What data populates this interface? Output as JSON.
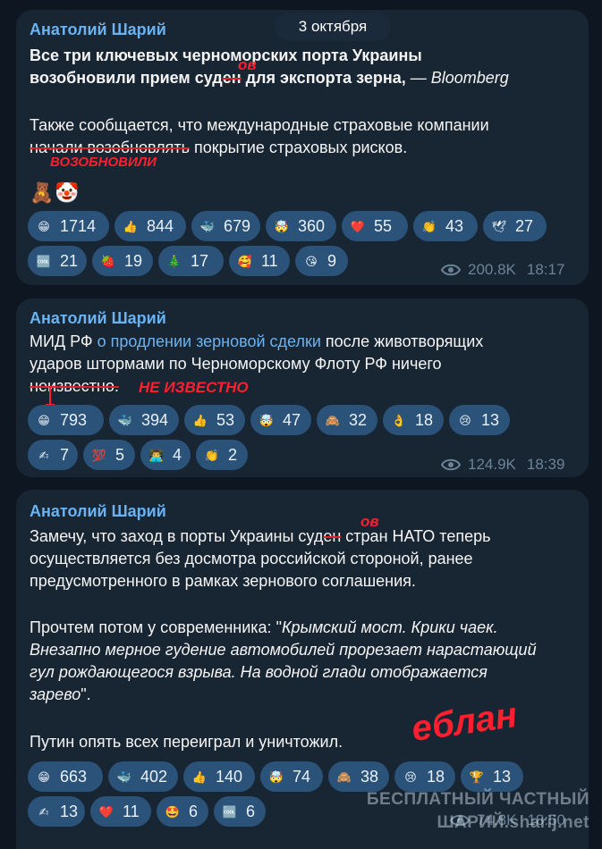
{
  "date_pill": "3 октября",
  "messages": [
    {
      "author": "Анатолий Шарий",
      "line1": "Все три ключевых черноморских порта Украины",
      "line2_a": "возобновили прием суд",
      "line2_strike": "ен",
      "line2_b": " для экспорта зерна,",
      "line2_c": " — ",
      "line2_src": "Bloomberg",
      "p2_line1": "Также сообщается, что международные страховые компании",
      "p2_strike": "начали возобновлять",
      "p2_rest": " покрытие страховых рисков.",
      "ann_ov": "ов",
      "ann_word": "ВОЗОБНОВИЛИ",
      "extra_emoji": [
        "🧸",
        "🤡"
      ],
      "reactions": [
        {
          "emoji": "😁",
          "count": "1714"
        },
        {
          "emoji": "👍",
          "count": "844"
        },
        {
          "emoji": "🐳",
          "count": "679"
        },
        {
          "emoji": "🤯",
          "count": "360"
        },
        {
          "emoji": "❤️",
          "count": "55"
        },
        {
          "emoji": "👏",
          "count": "43"
        },
        {
          "emoji": "🕊",
          "count": "27"
        },
        {
          "emoji": "🆒",
          "count": "21"
        },
        {
          "emoji": "🍓",
          "count": "19"
        },
        {
          "emoji": "🎄",
          "count": "17"
        },
        {
          "emoji": "🥰",
          "count": "11"
        },
        {
          "emoji": "😘",
          "count": "9"
        }
      ],
      "views": "200.8K",
      "time": "18:17"
    },
    {
      "author": "Анатолий Шарий",
      "l1_a": "МИД РФ ",
      "l1_link": "о продлении зерновой сделки",
      "l1_b": " после животворящих",
      "l2": "ударов штормами по Черноморскому Флоту РФ ничего",
      "l3_strike": "неизвестно.",
      "ann_word": "НЕ ИЗВЕСТНО",
      "reactions": [
        {
          "emoji": "😁",
          "count": "793"
        },
        {
          "emoji": "🐳",
          "count": "394"
        },
        {
          "emoji": "👍",
          "count": "53"
        },
        {
          "emoji": "🤯",
          "count": "47"
        },
        {
          "emoji": "🙈",
          "count": "32"
        },
        {
          "emoji": "👌",
          "count": "18"
        },
        {
          "emoji": "😢",
          "count": "13"
        },
        {
          "emoji": "✍",
          "count": "7"
        },
        {
          "emoji": "💯",
          "count": "5"
        },
        {
          "emoji": "👨‍💻",
          "count": "4"
        },
        {
          "emoji": "👏",
          "count": "2"
        }
      ],
      "views": "124.9K",
      "time": "18:39"
    },
    {
      "author": "Анатолий Шарий",
      "l1_a": "Замечу, что заход в порты Украины суд",
      "l1_strike": "ен",
      "l1_b": " стран НАТО теперь",
      "l2": "осуществляется без досмотра российской стороной, ранее",
      "l3": "предусмотренного в рамках зернового соглашения.",
      "l4_a": "Прочтем потом у современника: \"",
      "l4_i": "Крымский мост. Крики чаек.",
      "l5": "Внезапно мерное гудение автомобилей прорезает нарастающий",
      "l6": "гул рождающегося взрыва. На водной глади отображается",
      "l7_i": "зарево",
      "l7_b": "\".",
      "l8": "Путин опять всех переиграл и уничтожил.",
      "ann_ov": "ов",
      "ann_word": "еблан",
      "reactions": [
        {
          "emoji": "😁",
          "count": "663"
        },
        {
          "emoji": "🐳",
          "count": "402"
        },
        {
          "emoji": "👍",
          "count": "140"
        },
        {
          "emoji": "🤯",
          "count": "74"
        },
        {
          "emoji": "🙈",
          "count": "38"
        },
        {
          "emoji": "😢",
          "count": "18"
        },
        {
          "emoji": "🏆",
          "count": "13"
        },
        {
          "emoji": "✍",
          "count": "13"
        },
        {
          "emoji": "❤️",
          "count": "11"
        },
        {
          "emoji": "🤩",
          "count": "6"
        },
        {
          "emoji": "🆒",
          "count": "6"
        }
      ],
      "views": "74.8K",
      "time": "18:50"
    }
  ],
  "watermark": {
    "line1": "БЕСПЛАТНЫЙ ЧАСТНЫЙ",
    "line2": "ШАРИЙ.sharij.net"
  }
}
